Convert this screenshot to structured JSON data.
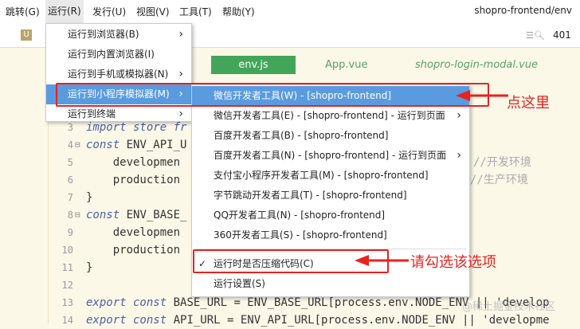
{
  "menubar": {
    "items": [
      "跳转(G)",
      "运行(R)",
      "发行(U)",
      "视图(V)",
      "工具(T)",
      "帮助(Y)"
    ],
    "title": "shopro-frontend/env"
  },
  "toolbar": {
    "project_icon": "U",
    "line_count": "401"
  },
  "tabs": [
    "env.js",
    "App.vue",
    "shopro-login-modal.vue"
  ],
  "run_menu": [
    "运行到浏览器(B)",
    "运行到内置浏览器(I)",
    "运行到手机或模拟器(N)",
    "运行到小程序模拟器(M)",
    "运行到终端"
  ],
  "submenu": [
    "微信开发者工具(W) - [shopro-frontend]",
    "微信开发者工具(E) - [shopro-frontend] - 运行到页面",
    "百度开发者工具(B) - [shopro-frontend]",
    "百度开发者工具(N) - [shopro-frontend] - 运行到页面",
    "支付宝小程序开发者工具(M) - [shopro-frontend]",
    "字节跳动开发者工具(T) - [shopro-frontend]",
    "QQ开发者工具(N) - [shopro-frontend]",
    "360开发者工具(S) - [shopro-frontend]",
    "运行时是否压缩代码(C)",
    "运行设置(S)"
  ],
  "code": {
    "l3": "import store fr",
    "l4a": "const",
    " l4b": " ENV_API_U",
    "l5": "    developmen",
    "l6": "    production",
    "l7": "}",
    "l8b": " ENV_BASE_",
    "l9": "    developmen",
    "l10": "    production",
    "l11": "}",
    "l13a": "export const",
    "l13b": " BASE_URL = ENV_BASE_URL[process.env.NODE_ENV || 'develop",
    "l14b": " API_URL = ENV_API_URL[process.env.NODE_ENV || 'developme",
    "c5": "//开发环境",
    "c6": "//生产环境"
  },
  "annotations": {
    "click_here": "点这里",
    "check_option": "请勾选该选项"
  },
  "watermark": "@稀土掘金技术社区",
  "colors": {
    "highlight": "#5a9be0",
    "annotation": "#e8221e",
    "tab_active": "#43a55a"
  }
}
